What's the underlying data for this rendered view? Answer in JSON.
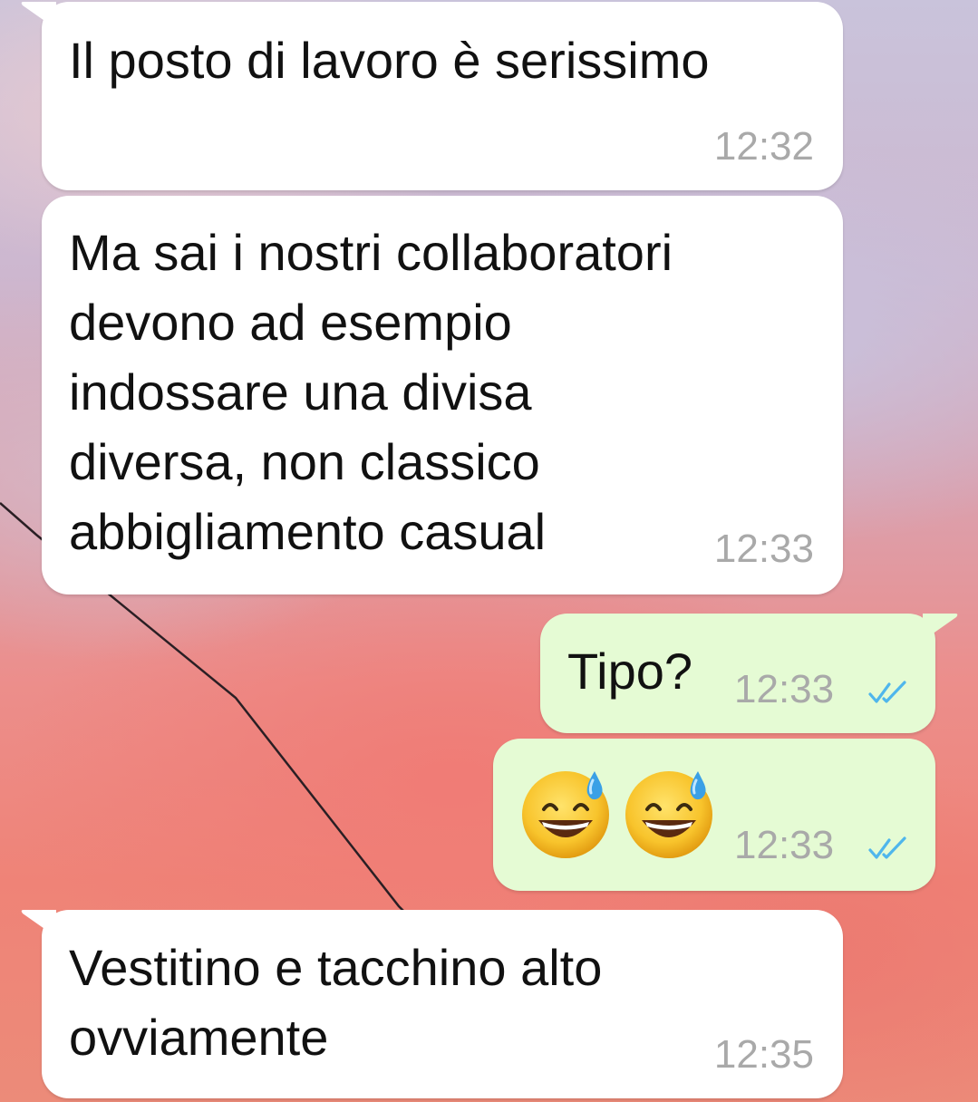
{
  "chat": {
    "messages": [
      {
        "direction": "incoming",
        "text_lines": [
          "Il posto di lavoro è serissimo"
        ],
        "time": "12:32"
      },
      {
        "direction": "incoming",
        "text_lines": [
          "Ma sai i nostri collaboratori",
          "devono ad esempio",
          "indossare una divisa",
          "diversa, non classico",
          "abbigliamento casual"
        ],
        "time": "12:33"
      },
      {
        "direction": "outgoing",
        "text": "Tipo?",
        "time": "12:33",
        "status_icon": "double-check-read-icon",
        "status_color": "#4fb6ec"
      },
      {
        "direction": "outgoing",
        "emoji": [
          "grinning-face-with-sweat-emoji",
          "grinning-face-with-sweat-emoji"
        ],
        "time": "12:33",
        "status_icon": "double-check-read-icon",
        "status_color": "#4fb6ec"
      },
      {
        "direction": "incoming",
        "text_lines": [
          "Vestitino e tacchino alto",
          "ovviamente"
        ],
        "time": "12:35"
      }
    ]
  },
  "colors": {
    "incoming_bubble": "#ffffff",
    "outgoing_bubble": "#e5fbd4",
    "timestamp": "#a9a9a9",
    "read_ticks": "#4fb6ec"
  },
  "wallpaper": "sunset-sky-with-power-line"
}
